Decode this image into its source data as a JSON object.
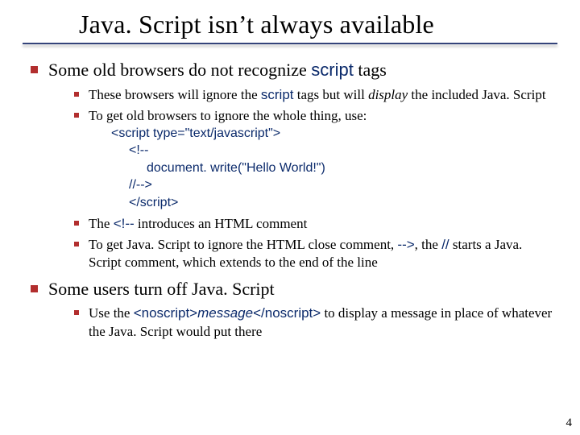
{
  "title": "Java. Script isn’t always available",
  "bullets": {
    "b1": {
      "text_pre": "Some old browsers do not recognize ",
      "code": "script",
      "text_post": " tags",
      "sub": {
        "s1_pre": "These browsers will ignore the ",
        "s1_code": "script",
        "s1_mid": " tags but will ",
        "s1_ital": "display",
        "s1_post": " the included Java. Script",
        "s2": "To get old browsers to ignore the whole thing, use:",
        "code": {
          "l1": "<script type=\"text/javascript\">",
          "l2": "<!--",
          "l3": "document. write(\"Hello World!\")",
          "l4": "//-->",
          "l5": "</script>"
        },
        "s3_pre": "The ",
        "s3_code": "<!--",
        "s3_post": " introduces an HTML comment",
        "s4_pre": "To get Java. Script to ignore the HTML close comment, ",
        "s4_code1": "-->",
        "s4_mid": ", the ",
        "s4_code2": "//",
        "s4_post": " starts a Java. Script comment, which extends to the end of the line"
      }
    },
    "b2": {
      "text": "Some users turn off Java. Script",
      "sub": {
        "s1_pre": "Use the ",
        "s1_code1": "<noscript>",
        "s1_msg": "message",
        "s1_code2": "</noscript>",
        "s1_post": " to display a message in place of whatever the Java. Script would put there"
      }
    }
  },
  "page_number": "4"
}
